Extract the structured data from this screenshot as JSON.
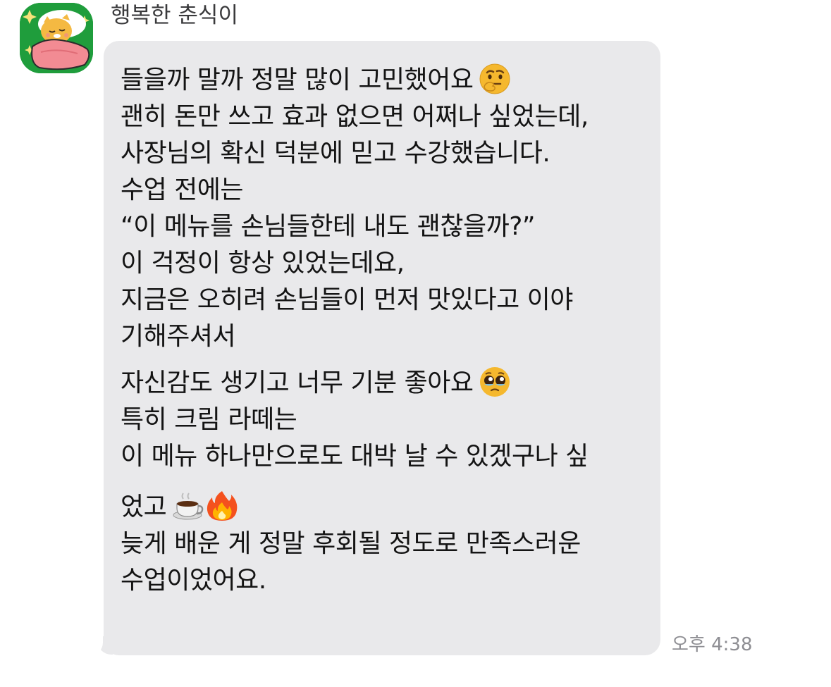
{
  "chat": {
    "sender_name": "행복한 춘식이",
    "avatar_icon": "choonsik-sleeping-avatar-icon",
    "timestamp": "오후 4:38",
    "message": {
      "lines": [
        "들을까 말까 정말 많이 고민했어요",
        "괜히 돈만 쓰고 효과 없으면 어쩌나 싶었는데,",
        "사장님의 확신 덕분에 믿고 수강했습니다.",
        "수업 전에는",
        "“이 메뉴를 손님들한테 내도 괜찮을까?”",
        "이 걱정이 항상 있었는데요,",
        "지금은 오히려 손님들이 먼저 맛있다고 이야",
        "기해주셔서",
        "자신감도 생기고 너무 기분 좋아요",
        "특히 크림 라떼는",
        "이 메뉴 하나만으로도 대박 날 수 있겠구나 싶",
        "었고",
        "늦게 배운 게 정말 후회될 정도로 만족스러운",
        "수업이었어요."
      ],
      "emojis": {
        "line1": "thinking-face-icon",
        "line9": "pleading-face-icon",
        "line12": [
          "hot-beverage-icon",
          "fire-icon"
        ]
      }
    }
  },
  "colors": {
    "bubble_bg": "#e9e9eb",
    "text": "#141414",
    "sender_text": "#3a3a3c",
    "timestamp_text": "#8e8e93",
    "avatar_bg": "#1f9d3c"
  }
}
